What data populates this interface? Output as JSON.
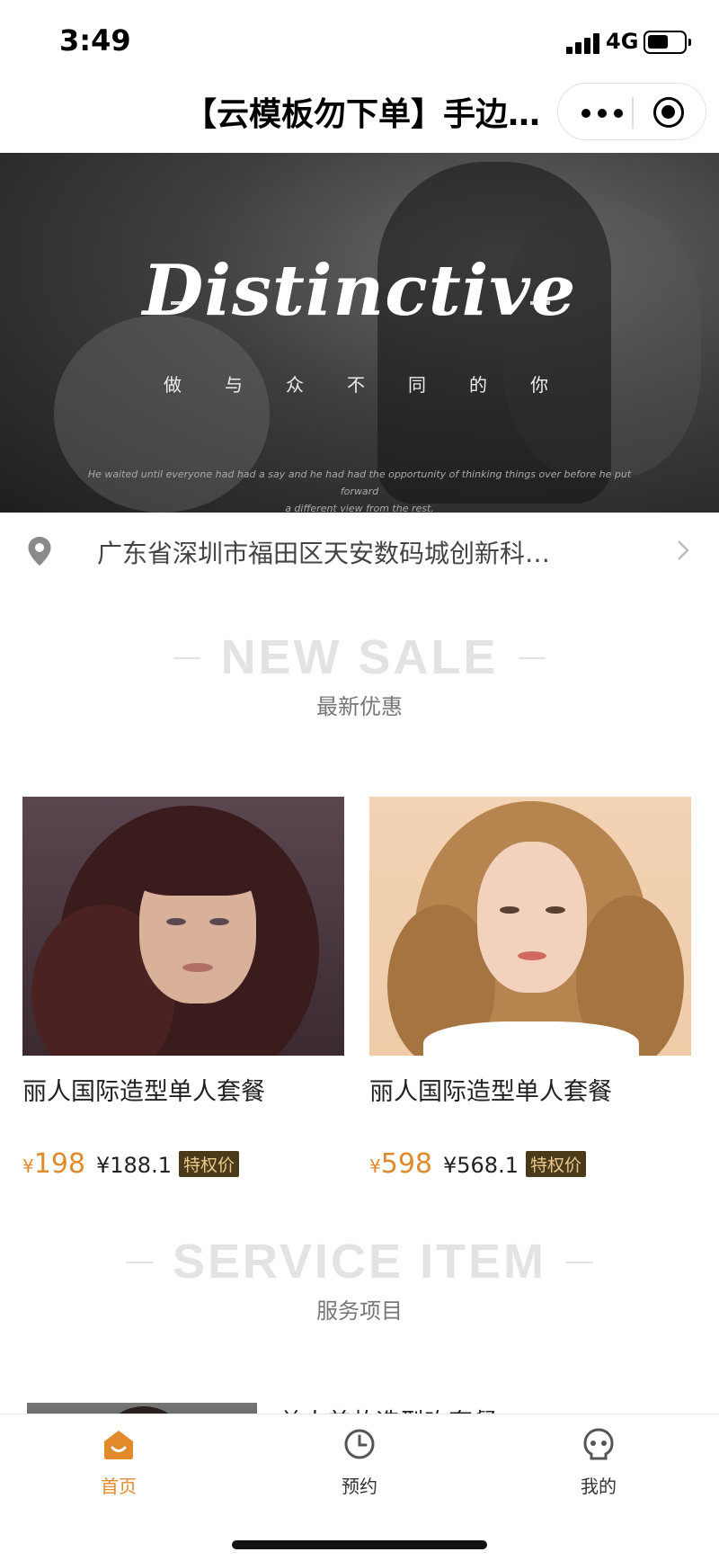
{
  "status_bar": {
    "time": "3:49",
    "network": "4G"
  },
  "nav": {
    "title": "【云模板勿下单】手边…"
  },
  "banner": {
    "headline": "Distinctive",
    "subtitle": "做与众不同的你",
    "quote_line1": "He waited until everyone had had a say and he had had the opportunity of thinking things over before he put forward",
    "quote_line2": "a different view from the rest."
  },
  "location": {
    "address": "广东省深圳市福田区天安数码城创新科…"
  },
  "new_sale": {
    "title_en": "NEW SALE",
    "title_cn": "最新优惠",
    "products": [
      {
        "name": "丽人国际造型单人套餐",
        "currency": "¥",
        "price": "198",
        "vip_price": "¥188.1",
        "badge": "特权价"
      },
      {
        "name": "丽人国际造型单人套餐",
        "currency": "¥",
        "price": "598",
        "vip_price": "¥568.1",
        "badge": "特权价"
      }
    ]
  },
  "service_items": {
    "title_en": "SERVICE ITEM",
    "title_cn": "服务项目",
    "first_item_title": "单人美妆造型吹套餐"
  },
  "tab_bar": {
    "tabs": [
      {
        "label": "首页",
        "icon": "home-icon",
        "active": true
      },
      {
        "label": "预约",
        "icon": "clock-icon",
        "active": false
      },
      {
        "label": "我的",
        "icon": "profile-icon",
        "active": false
      }
    ],
    "active_color": "#e08a2c",
    "inactive_color": "#333333"
  },
  "colors": {
    "accent": "#e08a2c",
    "badge_bg": "#4a3a1a",
    "badge_text": "#e8c98a"
  }
}
